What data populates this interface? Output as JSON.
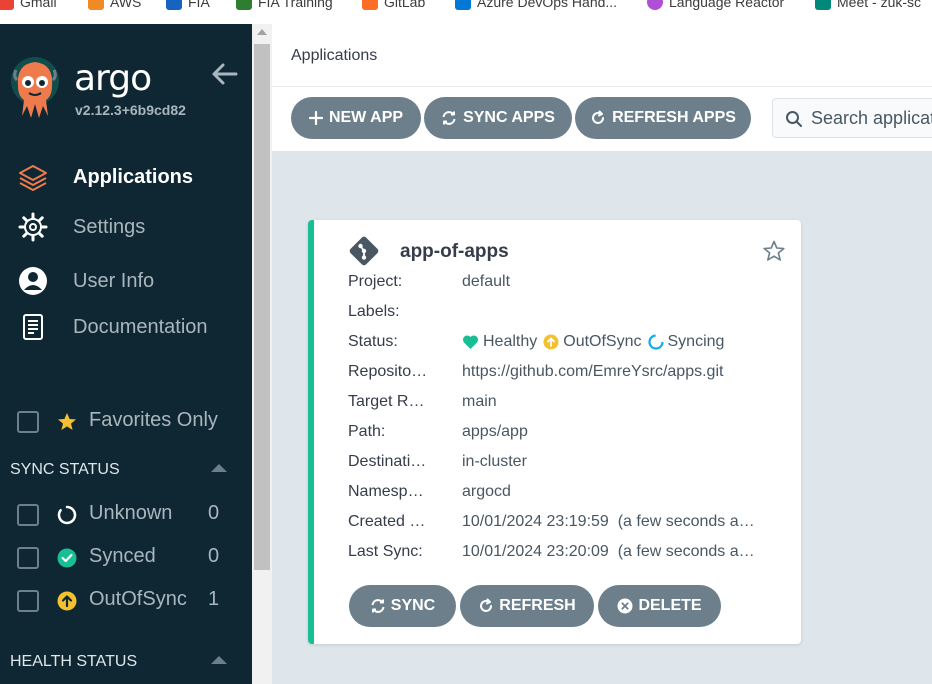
{
  "bookmarks": [
    {
      "label": "Gmail",
      "color": "#ea4335"
    },
    {
      "label": "AWS",
      "color": "#f08a24"
    },
    {
      "label": "FIA",
      "color": "#1565c0"
    },
    {
      "label": "FIA Training",
      "color": "#2e7d32"
    },
    {
      "label": "GitLab",
      "color": "#fc6d26"
    },
    {
      "label": "Azure DevOps Hand...",
      "color": "#0078d4"
    },
    {
      "label": "Language Reactor",
      "color": "#b04fd6"
    },
    {
      "label": "Meet - zuk-sc",
      "color": "#00897b"
    }
  ],
  "sidebar": {
    "brand": "argo",
    "version": "v2.12.3+6b9cd82",
    "nav": [
      {
        "label": "Applications",
        "icon": "layers-icon",
        "active": true
      },
      {
        "label": "Settings",
        "icon": "gear-icon",
        "active": false
      },
      {
        "label": "User Info",
        "icon": "user-circle-icon",
        "active": false
      },
      {
        "label": "Documentation",
        "icon": "book-icon",
        "active": false
      }
    ],
    "favorites_label": "Favorites Only",
    "sync_status": {
      "title": "SYNC STATUS",
      "items": [
        {
          "label": "Unknown",
          "count": "0"
        },
        {
          "label": "Synced",
          "count": "0"
        },
        {
          "label": "OutOfSync",
          "count": "1"
        }
      ]
    },
    "health_status": {
      "title": "HEALTH STATUS"
    }
  },
  "header": {
    "title": "Applications"
  },
  "toolbar": {
    "new_app": "NEW APP",
    "sync_apps": "SYNC APPS",
    "refresh_apps": "REFRESH APPS",
    "search_placeholder": "Search applications..."
  },
  "app_card": {
    "name": "app-of-apps",
    "rows": [
      {
        "label": "Project:",
        "value": "default"
      },
      {
        "label": "Labels:",
        "value": ""
      },
      {
        "label": "Status:",
        "value": ""
      },
      {
        "label": "Reposito…",
        "value": "https://github.com/EmreYsrc/apps.git"
      },
      {
        "label": "Target R…",
        "value": "main"
      },
      {
        "label": "Path:",
        "value": "apps/app"
      },
      {
        "label": "Destinati…",
        "value": "in-cluster"
      },
      {
        "label": "Namesp…",
        "value": "argocd"
      },
      {
        "label": "Created …",
        "value": "10/01/2024 23:19:59  (a few seconds a…"
      },
      {
        "label": "Last Sync:",
        "value": "10/01/2024 23:20:09  (a few seconds a…"
      }
    ],
    "status": {
      "health": "Healthy",
      "sync": "OutOfSync",
      "operation": "Syncing"
    },
    "buttons": {
      "sync": "SYNC",
      "refresh": "REFRESH",
      "delete": "DELETE"
    }
  },
  "colors": {
    "sidebar_bg": "#0f2733",
    "accent": "#18be94",
    "button": "#6d7f8b",
    "out_of_sync": "#f4c030",
    "healthy": "#18be94",
    "syncing": "#0dadea"
  }
}
